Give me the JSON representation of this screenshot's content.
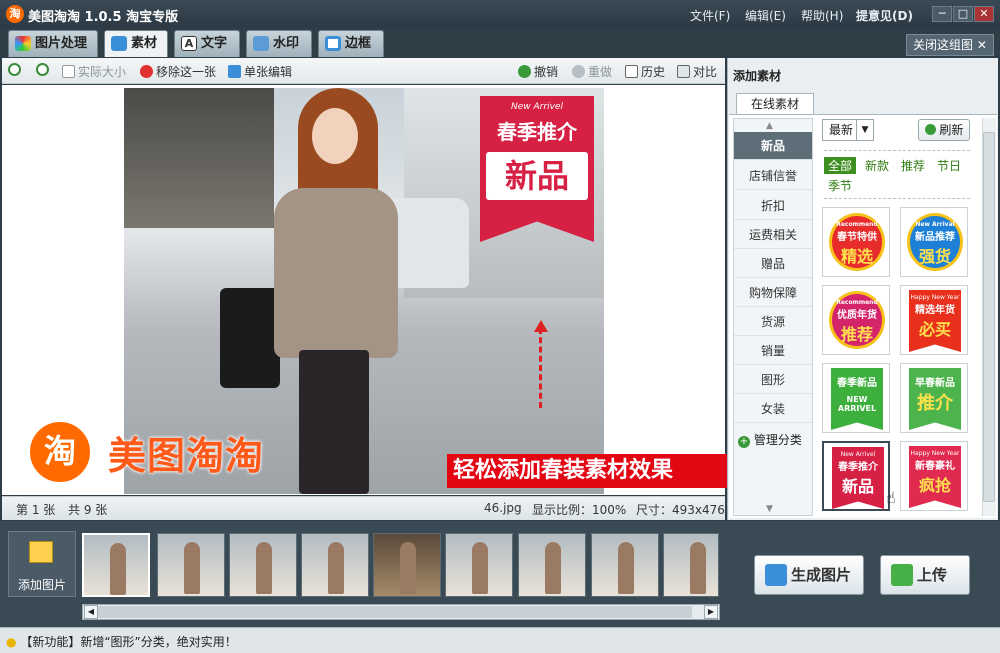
{
  "app": {
    "title": "美图淘淘 1.0.5 淘宝专版",
    "logo_char": "淘"
  },
  "menu": {
    "file": "文件(F)",
    "edit": "编辑(E)",
    "help": "帮助(H)",
    "feedback": "提意见(D)"
  },
  "window_controls": {
    "restore": "▭",
    "minimize": "─",
    "maximize": "□",
    "close": "✕"
  },
  "tabs": [
    {
      "label": "图片处理",
      "icon": "palette-icon"
    },
    {
      "label": "素材",
      "icon": "material-icon"
    },
    {
      "label": "文字",
      "icon": "text-icon"
    },
    {
      "label": "水印",
      "icon": "watermark-icon"
    },
    {
      "label": "边框",
      "icon": "frame-icon"
    }
  ],
  "close_group": "关闭这组图",
  "toolbar": {
    "actual_size": "实际大小",
    "remove_one": "移除这一张",
    "single_edit": "单张编辑",
    "undo": "撤销",
    "redo": "重做",
    "history": "历史",
    "compare": "对比"
  },
  "canvas": {
    "sticker_top": "New Arrivel",
    "sticker_main": "春季推介",
    "sticker_big": "新品",
    "logo_char": "淘",
    "logo_text": "美图淘淘",
    "promo": "轻松添加春装素材效果"
  },
  "status": {
    "page": "第 1 张",
    "total": "共 9 张",
    "filename": "46.jpg",
    "ratio": "显示比例：100%",
    "size": "尺寸：493x476"
  },
  "right_panel": {
    "title": "添加素材",
    "tab": "在线素材",
    "categories": [
      "新品",
      "店铺信誉",
      "折扣",
      "运费相关",
      "赠品",
      "购物保障",
      "货源",
      "销量",
      "图形",
      "女装"
    ],
    "manage": "管理分类",
    "sort": "最新",
    "refresh": "刷新",
    "filters": [
      "全部",
      "新款",
      "推荐",
      "节日",
      "季节"
    ],
    "thumbs": [
      {
        "top": "Recommend",
        "l1": "春节特供",
        "l2": "精选",
        "color": "#e82b2b"
      },
      {
        "top": "New Arrival",
        "l1": "新品推荐",
        "l2": "强货",
        "color": "#1e7fd6"
      },
      {
        "top": "Recommend",
        "l1": "优质年货",
        "l2": "推荐",
        "color": "#d4246a"
      },
      {
        "top": "Happy New Year",
        "l1": "精选年货",
        "l2": "必买",
        "color": "#e8301c"
      },
      {
        "top": "",
        "l1": "春季新品",
        "l2": "NEW ARRIVEL",
        "color": "#3daf3d"
      },
      {
        "top": "",
        "l1": "早春新品",
        "l2": "推介",
        "color": "#4db34d"
      },
      {
        "top": "New Arrivel",
        "l1": "春季推介",
        "l2": "新品",
        "color": "#d62044"
      },
      {
        "top": "Happy New Year",
        "l1": "新春豪礼",
        "l2": "疯抢",
        "color": "#e02a50"
      }
    ]
  },
  "filmstrip": {
    "add_photo": "添加图片",
    "count": 9
  },
  "actions": {
    "generate": "生成图片",
    "upload": "上传"
  },
  "tip": "【新功能】新增“图形”分类，绝对实用！"
}
